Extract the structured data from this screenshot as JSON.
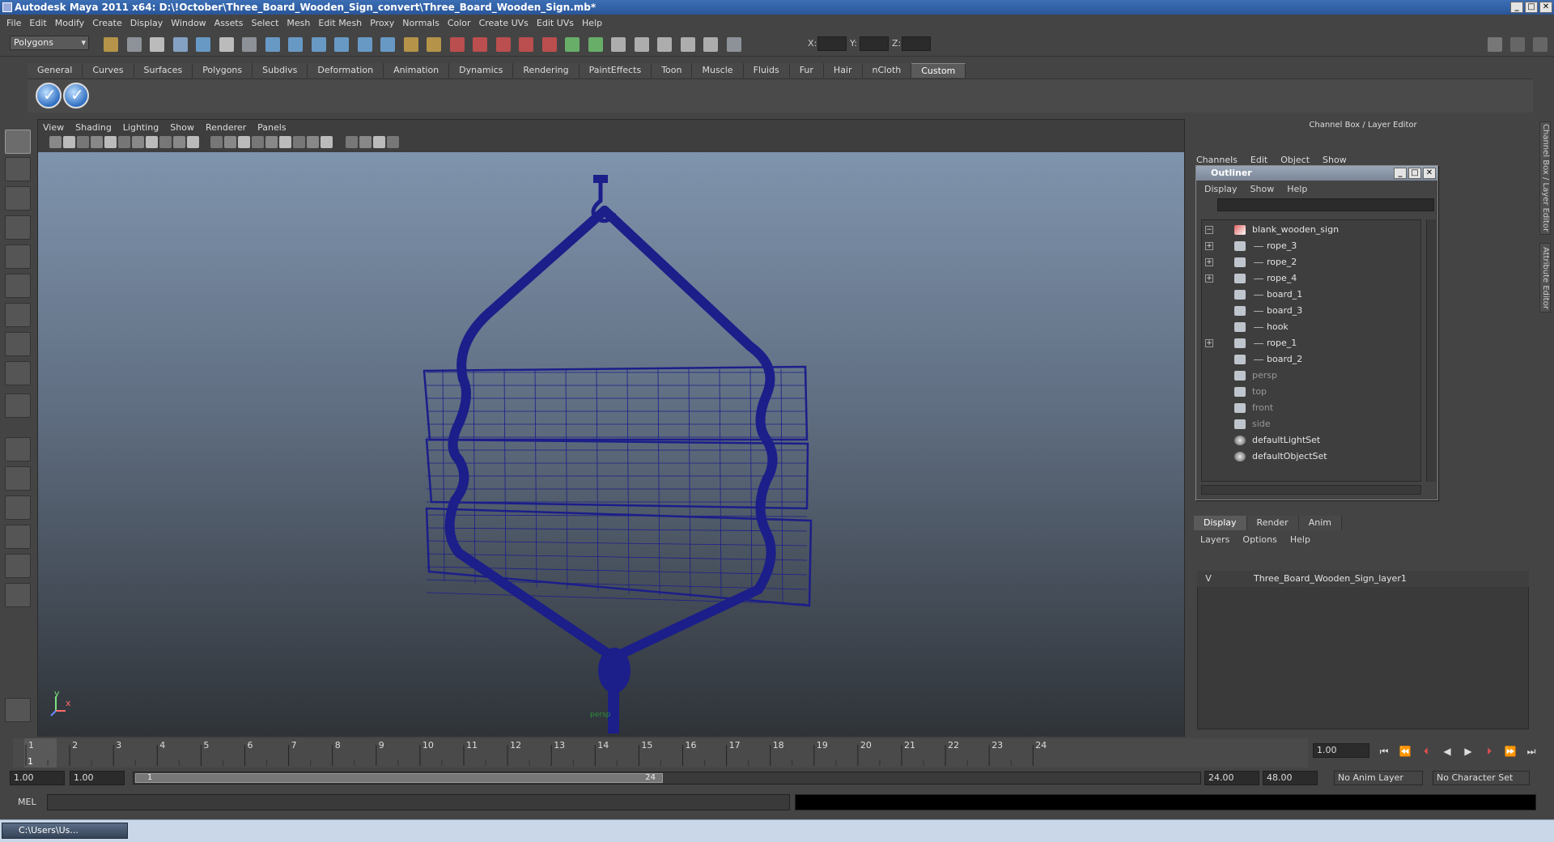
{
  "window": {
    "title": "Autodesk Maya 2011 x64: D:\\!October\\Three_Board_Wooden_Sign_convert\\Three_Board_Wooden_Sign.mb*",
    "min": "_",
    "max": "□",
    "close": "✕"
  },
  "menubar": [
    "File",
    "Edit",
    "Modify",
    "Create",
    "Display",
    "Window",
    "Assets",
    "Select",
    "Mesh",
    "Edit Mesh",
    "Proxy",
    "Normals",
    "Color",
    "Create UVs",
    "Edit UVs",
    "Help"
  ],
  "statusline": {
    "mode": "Polygons",
    "x_label": "X:",
    "y_label": "Y:",
    "z_label": "Z:"
  },
  "shelf_tabs": [
    "General",
    "Curves",
    "Surfaces",
    "Polygons",
    "Subdivs",
    "Deformation",
    "Animation",
    "Dynamics",
    "Rendering",
    "PaintEffects",
    "Toon",
    "Muscle",
    "Fluids",
    "Fur",
    "Hair",
    "nCloth",
    "Custom"
  ],
  "shelf_active": "Custom",
  "panel_menu": [
    "View",
    "Shading",
    "Lighting",
    "Show",
    "Renderer",
    "Panels"
  ],
  "viewport": {
    "axis_y": "y",
    "axis_x": "x",
    "wire_color": "#1c1e8a",
    "mesh_name": "persp"
  },
  "channel_box": {
    "header": "Channel Box / Layer Editor",
    "menu": [
      "Channels",
      "Edit",
      "Object",
      "Show"
    ],
    "side_tabs": [
      "Channel Box / Layer Editor",
      "Attribute Editor"
    ]
  },
  "outliner": {
    "title": "Outliner",
    "menu": [
      "Display",
      "Show",
      "Help"
    ],
    "items": [
      {
        "label": "blank_wooden_sign",
        "level": 0,
        "expander": "−",
        "dim": false
      },
      {
        "label": "rope_3",
        "level": 1,
        "expander": "+",
        "dim": false
      },
      {
        "label": "rope_2",
        "level": 1,
        "expander": "+",
        "dim": false
      },
      {
        "label": "rope_4",
        "level": 1,
        "expander": "+",
        "dim": false
      },
      {
        "label": "board_1",
        "level": 1,
        "expander": "",
        "dim": false
      },
      {
        "label": "board_3",
        "level": 1,
        "expander": "",
        "dim": false
      },
      {
        "label": "hook",
        "level": 1,
        "expander": "",
        "dim": false
      },
      {
        "label": "rope_1",
        "level": 1,
        "expander": "+",
        "dim": false
      },
      {
        "label": "board_2",
        "level": 1,
        "expander": "",
        "dim": false
      },
      {
        "label": "persp",
        "level": 0,
        "expander": "",
        "dim": true
      },
      {
        "label": "top",
        "level": 0,
        "expander": "",
        "dim": true
      },
      {
        "label": "front",
        "level": 0,
        "expander": "",
        "dim": true
      },
      {
        "label": "side",
        "level": 0,
        "expander": "",
        "dim": true
      },
      {
        "label": "defaultLightSet",
        "level": 0,
        "expander": "",
        "dim": false
      },
      {
        "label": "defaultObjectSet",
        "level": 0,
        "expander": "",
        "dim": false
      }
    ]
  },
  "layer_editor": {
    "tabs": [
      "Display",
      "Render",
      "Anim"
    ],
    "active_tab": "Display",
    "menu": [
      "Layers",
      "Options",
      "Help"
    ],
    "layer": {
      "visible": "V",
      "name": "Three_Board_Wooden_Sign_layer1"
    }
  },
  "timeline": {
    "frames": [
      "1",
      "2",
      "3",
      "4",
      "5",
      "6",
      "7",
      "8",
      "9",
      "10",
      "11",
      "12",
      "13",
      "14",
      "15",
      "16",
      "17",
      "18",
      "19",
      "20",
      "21",
      "22",
      "23",
      "24"
    ],
    "current_frame_marker": "1",
    "current_time": "1.00"
  },
  "range": {
    "start_time": "1.00",
    "playback_start": "1.00",
    "handle_start": "1",
    "handle_end": "24",
    "playback_end": "24.00",
    "end_time": "48.00",
    "anim_layer": "No Anim Layer",
    "character_set": "No Character Set"
  },
  "command_line": {
    "label": "MEL"
  },
  "taskbar": {
    "item": "C:\\Users\\Us..."
  }
}
